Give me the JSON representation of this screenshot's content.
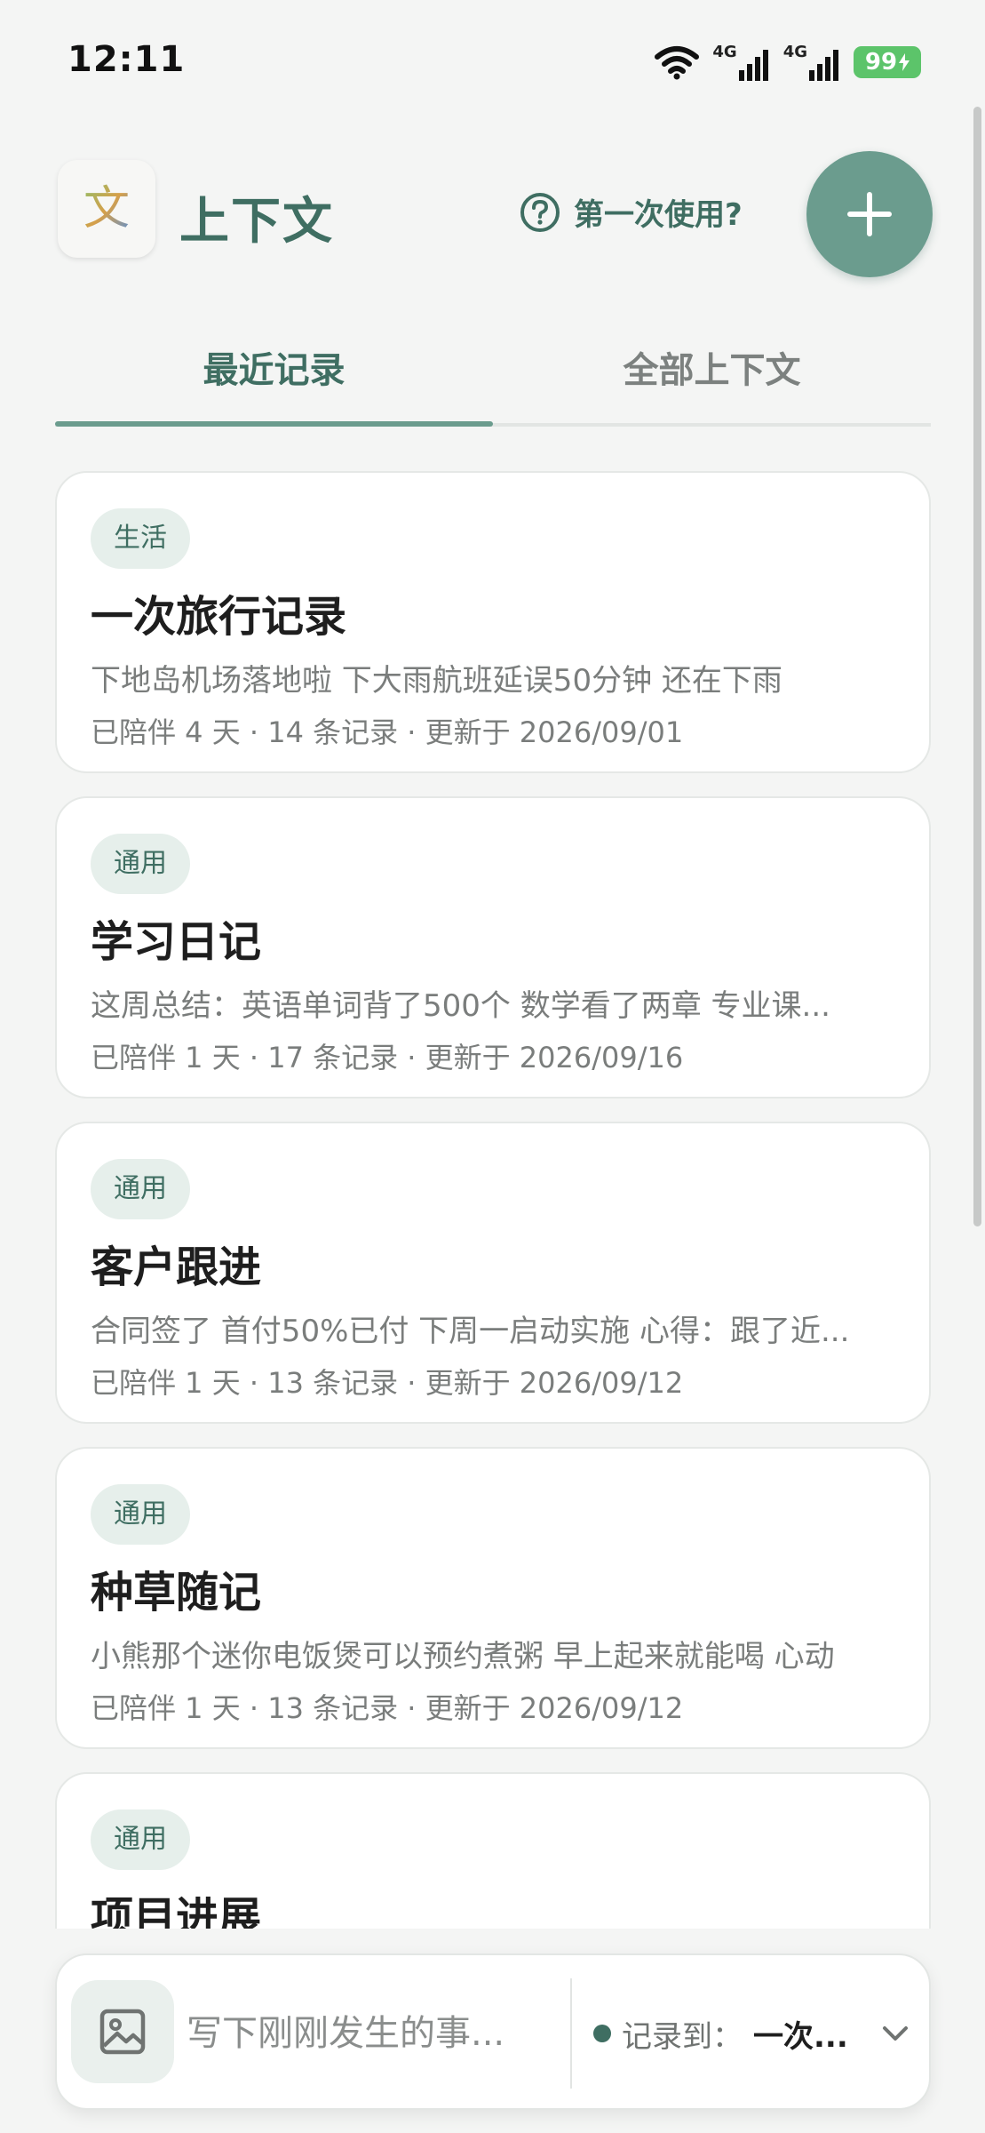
{
  "status_bar": {
    "time": "12:11",
    "network_1": "4G",
    "network_2": "4G",
    "battery": "99"
  },
  "header": {
    "app_logo_char": "文",
    "app_title": "上下文",
    "help_label": "第一次使用?"
  },
  "tabs": [
    {
      "label": "最近记录",
      "active": true
    },
    {
      "label": "全部上下文",
      "active": false
    }
  ],
  "cards": [
    {
      "tag": "生活",
      "title": "一次旅行记录",
      "preview": "下地岛机场落地啦 下大雨航班延误50分钟 还在下雨",
      "meta": "已陪伴 4 天 · 14 条记录 · 更新于 2026/09/01"
    },
    {
      "tag": "通用",
      "title": "学习日记",
      "preview": "这周总结：英语单词背了500个 数学看了两章 专业课...",
      "meta": "已陪伴 1 天 · 17 条记录 · 更新于 2026/09/16"
    },
    {
      "tag": "通用",
      "title": "客户跟进",
      "preview": "合同签了 首付50%已付 下周一启动实施 心得：跟了近...",
      "meta": "已陪伴 1 天 · 13 条记录 · 更新于 2026/09/12"
    },
    {
      "tag": "通用",
      "title": "种草随记",
      "preview": "小熊那个迷你电饭煲可以预约煮粥 早上起来就能喝 心动",
      "meta": "已陪伴 1 天 · 13 条记录 · 更新于 2026/09/12"
    },
    {
      "tag": "通用",
      "title": "项目进展",
      "preview": "",
      "meta": ""
    }
  ],
  "composer": {
    "placeholder": "写下刚刚发生的事...",
    "target_label": "记录到：",
    "target_value": "一次..."
  },
  "colors": {
    "accent": "#6b9c8e",
    "accent_dark": "#3f6e62",
    "background": "#f4f5f4",
    "battery": "#5cc46a"
  }
}
